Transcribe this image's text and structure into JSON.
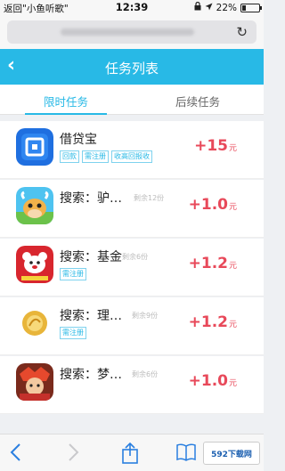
{
  "status_bar": {
    "carrier": "返回\"小鱼听歌\"",
    "time": "12:39",
    "battery": "22%",
    "battery_level": 0.22
  },
  "nav": {
    "title": "任务列表"
  },
  "tabs": [
    {
      "label": "限时任务"
    },
    {
      "label": "后续任务"
    }
  ],
  "tasks": [
    {
      "name": "借贷宝",
      "sub": "",
      "tags": [
        "回款",
        "需注册",
        "收高回报收"
      ],
      "reward": "+15",
      "unit": "元",
      "icon": "jiedaibao-icon"
    },
    {
      "name": "搜索：驴…",
      "sub": "剩余12份",
      "tags": [],
      "reward": "+1.0",
      "unit": "元",
      "icon": "cow-game-icon"
    },
    {
      "name": "搜索：基金",
      "sub": "剩余6份",
      "tags": [
        "需注册"
      ],
      "reward": "+1.2",
      "unit": "元",
      "icon": "bear-app-icon"
    },
    {
      "name": "搜索：理…",
      "sub": "剩余9份",
      "tags": [
        "需注册"
      ],
      "reward": "+1.2",
      "unit": "元",
      "icon": "gold-coin-icon"
    },
    {
      "name": "搜索：梦…",
      "sub": "剩余6份",
      "tags": [],
      "reward": "+1.0",
      "unit": "元",
      "icon": "hero-game-icon"
    }
  ],
  "toolbar": {
    "watermark": "592下载网"
  },
  "colors": {
    "accent": "#28b9e6",
    "reward": "#e8495a"
  }
}
